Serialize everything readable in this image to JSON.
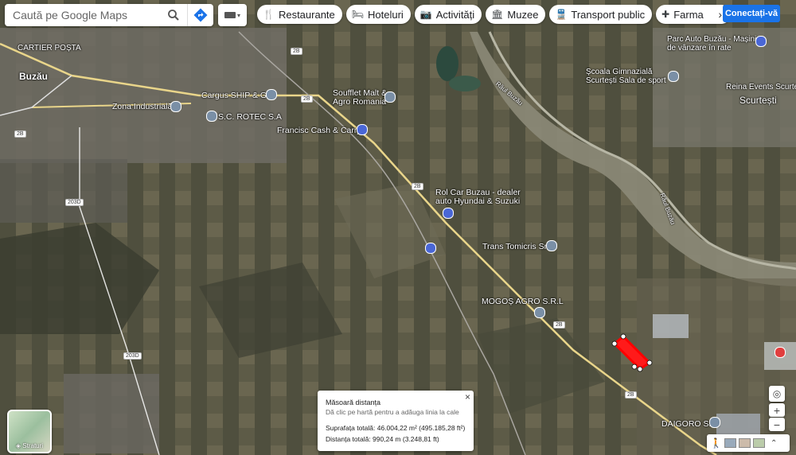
{
  "search": {
    "placeholder": "Caută pe Google Maps"
  },
  "chips": [
    {
      "icon": "restaurant-icon",
      "glyph": "🍴",
      "label": "Restaurante"
    },
    {
      "icon": "hotel-icon",
      "glyph": "🛏",
      "label": "Hoteluri"
    },
    {
      "icon": "camera-icon",
      "glyph": "📷",
      "label": "Activități"
    },
    {
      "icon": "museum-icon",
      "glyph": "🏛",
      "label": "Muzee"
    },
    {
      "icon": "transit-icon",
      "glyph": "🚆",
      "label": "Transport public"
    },
    {
      "icon": "pharmacy-icon",
      "glyph": "✚",
      "label": "Farma"
    }
  ],
  "signin_label": "Conectați-vă",
  "layers_label": "Straturi",
  "labels": {
    "cartier_posta": "CARTIER POȘTA",
    "buzau": "Buzău",
    "zona_industriala": "Zona Industrială",
    "cargus": "Cargus SHIP & GO",
    "rotec": "S.C. ROTEC S.A",
    "soufflet": "Soufflet Malt &\nAgro Romania",
    "francisc": "Francisc Cash & Carry",
    "rol_car": "Rol Car Buzau - dealer\nauto Hyundai & Suzuki",
    "trans_tomicris": "Trans Tomicris Srl",
    "mogos": "MOGOȘ AGRO S.R.L",
    "daigoro": "DAIGORO SRL",
    "parc_auto": "Parc Auto Buzău - Mașini\nde vânzare în rate",
    "scoala": "Școala Gimnazială\nScurtești Sala de sport",
    "reina": "Reina Events Scurte",
    "scurtesti": "Scurtești",
    "raul_buzau_1": "Râul Buzău",
    "raul_buzau_2": "Râul Buzău"
  },
  "road_numbers": [
    "2B",
    "2B",
    "2B",
    "2B",
    "2B",
    "2B",
    "203D",
    "203D"
  ],
  "measure": {
    "title": "Măsoară distanța",
    "subtitle": "Dă clic pe hartă pentru a adăuga linia la cale",
    "area": "Suprafața totală: 46.004,22 m² (495.185,28 ft²)",
    "distance": "Distanța totală: 990,24 m (3.248,81 ft)"
  }
}
